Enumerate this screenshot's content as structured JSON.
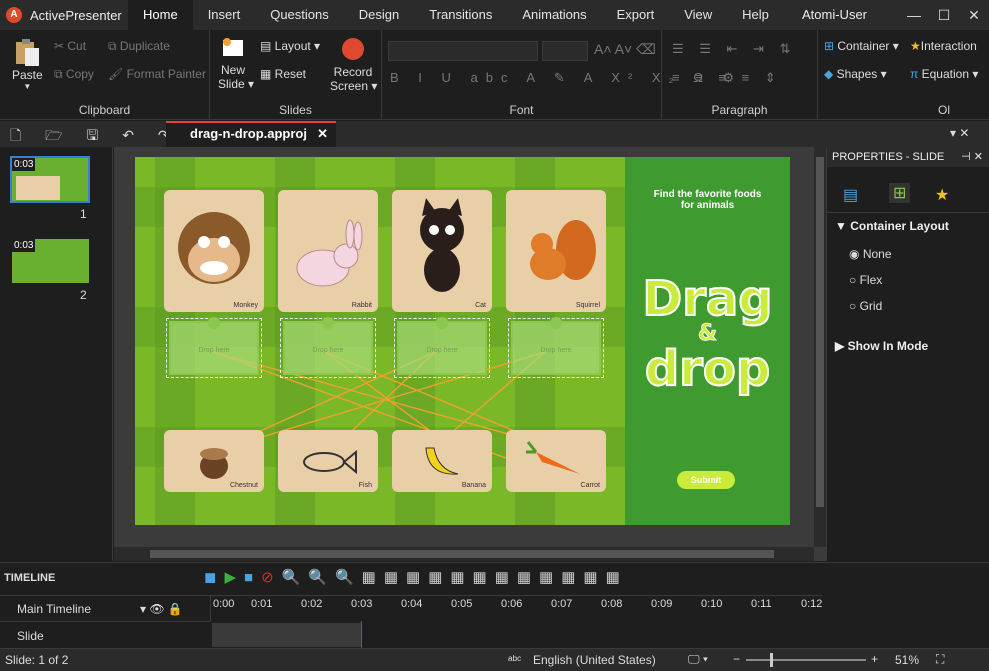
{
  "app": {
    "name": "ActivePresenter",
    "user": "Atomi-User"
  },
  "menu": [
    "Home",
    "Insert",
    "Questions",
    "Design",
    "Transitions",
    "Animations",
    "Export",
    "View",
    "Help"
  ],
  "ribbon": {
    "clipboard": {
      "label": "Clipboard",
      "paste": "Paste",
      "cut": "Cut",
      "copy": "Copy",
      "duplicate": "Duplicate",
      "format_painter": "Format Painter"
    },
    "slides": {
      "label": "Slides",
      "new_slide_1": "New",
      "new_slide_2": "Slide",
      "layout": "Layout",
      "reset": "Reset",
      "record_1": "Record",
      "record_2": "Screen"
    },
    "font": {
      "label": "Font"
    },
    "paragraph": {
      "label": "Paragraph"
    },
    "other": {
      "container": "Container",
      "interaction": "Interaction",
      "shapes": "Shapes",
      "equation": "Equation",
      "label_partial": "Ol"
    }
  },
  "document": {
    "tab": "drag-n-drop.approj"
  },
  "thumbnails": [
    {
      "time": "0:03",
      "num": "1"
    },
    {
      "time": "0:03",
      "num": "2"
    }
  ],
  "slide": {
    "title_line1": "Find the favorite foods",
    "title_line2": "for animals",
    "logo_1": "Drag",
    "logo_2": "&",
    "logo_3": "drop",
    "animals": [
      "Monkey",
      "Rabbit",
      "Cat",
      "Squirrel"
    ],
    "drop_text": "Drop here",
    "foods": [
      "Chestnut",
      "Fish",
      "Banana",
      "Carrot"
    ],
    "submit": "Submit"
  },
  "properties": {
    "header": "PROPERTIES - SLIDE",
    "section1": "Container Layout",
    "options": [
      "None",
      "Flex",
      "Grid"
    ],
    "selected": "None",
    "section2": "Show In Mode"
  },
  "timeline": {
    "title": "TIMELINE",
    "main": "Main Timeline",
    "row": "Slide",
    "ticks": [
      "0:00",
      "0:01",
      "0:02",
      "0:03",
      "0:04",
      "0:05",
      "0:06",
      "0:07",
      "0:08",
      "0:09",
      "0:10",
      "0:11",
      "0:12"
    ]
  },
  "status": {
    "slide": "Slide: 1 of 2",
    "language": "English (United States)",
    "zoom": "51%"
  },
  "colors": {
    "accent": "#e0492d",
    "green": "#7ab828",
    "dark_green": "#3f9a2f"
  }
}
